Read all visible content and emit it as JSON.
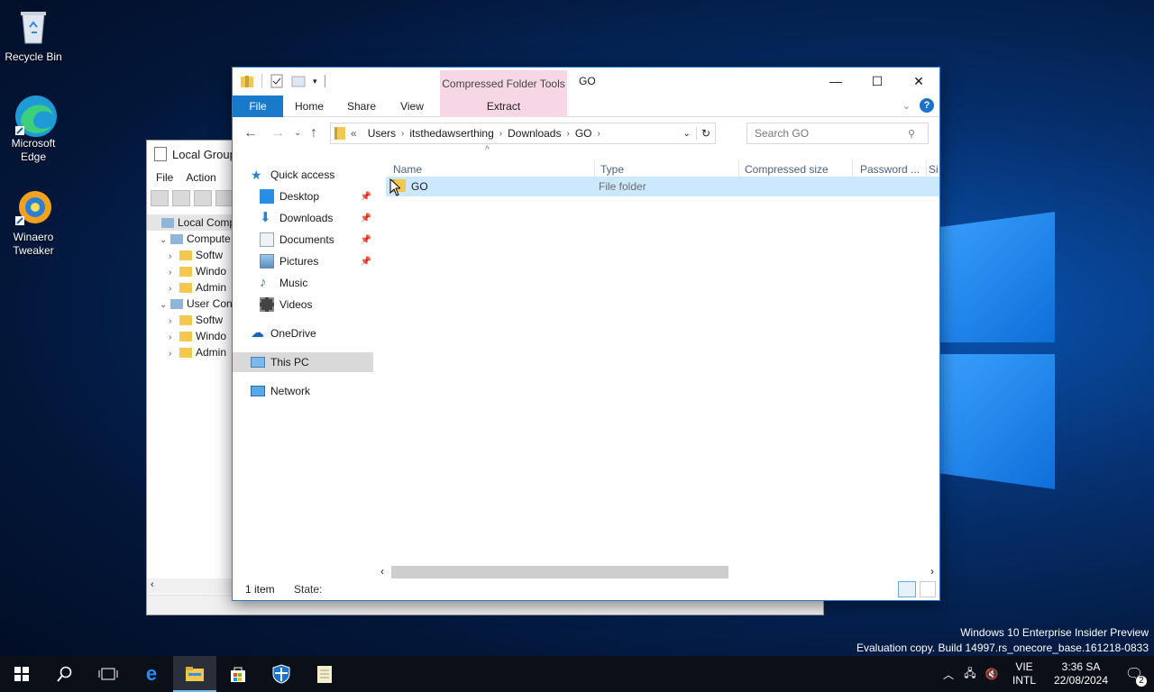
{
  "desktop": {
    "icons": [
      {
        "label": "Recycle Bin",
        "icon": "recycle-bin-icon"
      },
      {
        "label": "Microsoft Edge",
        "icon": "edge-icon"
      },
      {
        "label": "Winaero Tweaker",
        "icon": "winaero-tweaker-icon"
      }
    ],
    "watermark_line1": "Windows 10 Enterprise Insider Preview",
    "watermark_line2": "Evaluation copy. Build 14997.rs_onecore_base.161218-0833"
  },
  "gpedit": {
    "title": "Local Group",
    "menu": [
      "File",
      "Action"
    ],
    "tree": [
      {
        "label": "Local Compu",
        "indent": 0,
        "arrow": ""
      },
      {
        "label": "Compute",
        "indent": 1,
        "arrow": "v"
      },
      {
        "label": "Softw",
        "indent": 2,
        "arrow": ">"
      },
      {
        "label": "Windo",
        "indent": 2,
        "arrow": ">"
      },
      {
        "label": "Admin",
        "indent": 2,
        "arrow": ">"
      },
      {
        "label": "User Cont",
        "indent": 1,
        "arrow": "v"
      },
      {
        "label": "Softw",
        "indent": 2,
        "arrow": ">"
      },
      {
        "label": "Windo",
        "indent": 2,
        "arrow": ">"
      },
      {
        "label": "Admin",
        "indent": 2,
        "arrow": ">"
      }
    ]
  },
  "explorer": {
    "title": "GO",
    "context_tab": "Compressed Folder Tools",
    "ribbon_tabs": [
      "File",
      "Home",
      "Share",
      "View",
      "Extract"
    ],
    "caption": {
      "minimize": "—",
      "maximize": "☐",
      "close": "✕"
    },
    "breadcrumb_prefix": "«",
    "breadcrumb": [
      "Users",
      "itsthedawserthing",
      "Downloads",
      "GO"
    ],
    "search_placeholder": "Search GO",
    "nav": {
      "quick_access": "Quick access",
      "pinned": [
        "Desktop",
        "Downloads",
        "Documents",
        "Pictures"
      ],
      "unpinned": [
        "Music",
        "Videos"
      ],
      "onedrive": "OneDrive",
      "this_pc": "This PC",
      "network": "Network"
    },
    "columns": [
      "Name",
      "Type",
      "Compressed size",
      "Password ...",
      "Si"
    ],
    "rows": [
      {
        "name": "GO",
        "type": "File folder"
      }
    ],
    "status_count": "1 item",
    "status_state": "State:"
  },
  "taskbar": {
    "apps": [
      "start-icon",
      "search-icon",
      "task-view-icon",
      "edge-icon",
      "file-explorer-icon",
      "store-icon",
      "defender-icon",
      "notepad-icon"
    ],
    "lang_top": "VIE",
    "lang_bottom": "INTL",
    "time": "3:36 SA",
    "date": "22/08/2024",
    "notification_count": "2"
  },
  "colors": {
    "accent": "#1979ca",
    "context_tab": "#f7d6e6",
    "selection": "#cce8ff"
  }
}
